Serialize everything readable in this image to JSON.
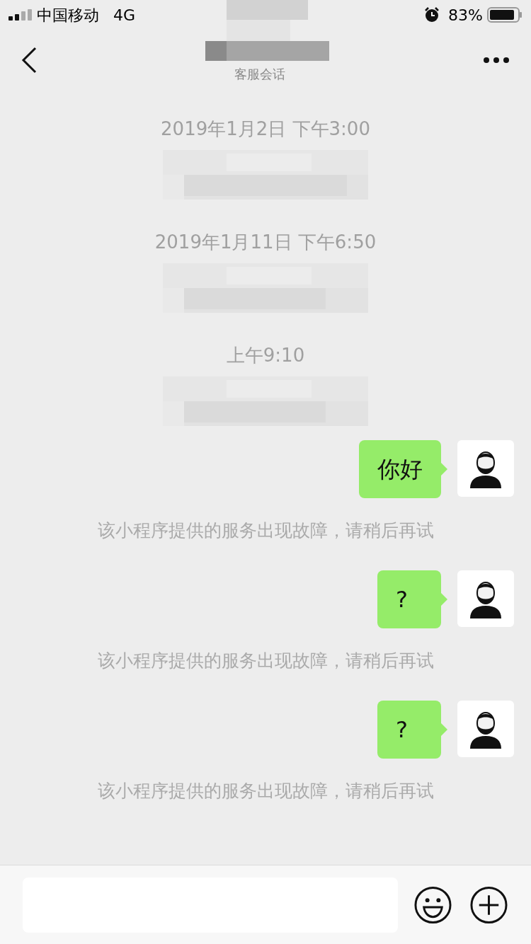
{
  "status_bar": {
    "carrier": "中国移动",
    "network": "4G",
    "battery": "83%"
  },
  "nav": {
    "subtitle": "客服会话"
  },
  "items": [
    {
      "kind": "timestamp",
      "text": "2019年1月2日 下午3:00"
    },
    {
      "kind": "timestamp",
      "text": "2019年1月11日 下午6:50"
    },
    {
      "kind": "timestamp",
      "text": "上午9:10"
    },
    {
      "kind": "message",
      "text": "你好"
    },
    {
      "kind": "system",
      "text": "该小程序提供的服务出现故障，请稍后再试"
    },
    {
      "kind": "message",
      "text": "?"
    },
    {
      "kind": "system",
      "text": "该小程序提供的服务出现故障，请稍后再试"
    },
    {
      "kind": "message",
      "text": "?"
    },
    {
      "kind": "system",
      "text": "该小程序提供的服务出现故障，请稍后再试"
    }
  ]
}
